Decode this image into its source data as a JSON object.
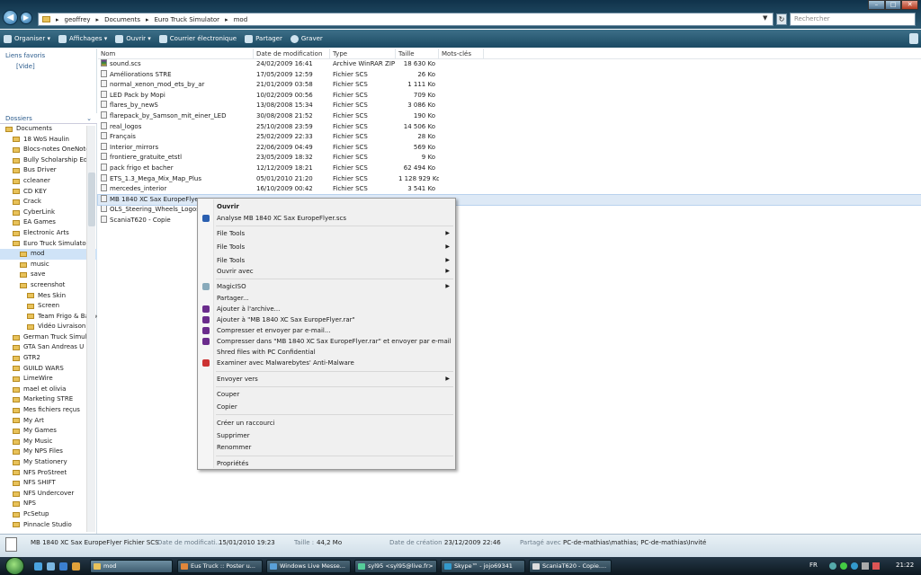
{
  "address": {
    "crumbs": [
      "geoffrey",
      "Documents",
      "Euro Truck Simulator",
      "mod"
    ],
    "search_placeholder": "Rechercher",
    "back_icon": "back-arrow-icon",
    "forward_icon": "forward-arrow-icon"
  },
  "toolbar": {
    "organiser": "Organiser",
    "affichages": "Affichages",
    "ouvrir": "Ouvrir",
    "courrier": "Courrier électronique",
    "partager": "Partager",
    "graver": "Graver"
  },
  "left": {
    "favorites_title": "Liens favoris",
    "favorites_empty": "[Vide]",
    "folders_title": "Dossiers",
    "folders": [
      "Documents",
      "18 WoS Haulin",
      "Blocs-notes OneNote",
      "Bully Scholarship Ed",
      "Bus Driver",
      "ccleaner",
      "CD KEY",
      "Crack",
      "CyberLink",
      "EA Games",
      "Electronic Arts",
      "Euro Truck Simulator",
      "mod",
      "music",
      "save",
      "screenshot",
      "Mes Skin",
      "Screen",
      "Team Frigo & Bache",
      "Vidéo Livraison de",
      "German Truck Simul",
      "GTA San Andreas U",
      "GTR2",
      "GUILD WARS",
      "LimeWire",
      "mael et olivia",
      "Marketing STRE",
      "Mes fichiers reçus",
      "My Art",
      "My Games",
      "My Music",
      "My NPS Files",
      "My Stationery",
      "NFS ProStreet",
      "NFS SHIFT",
      "NFS Undercover",
      "NPS",
      "PcSetup",
      "Pinnacle Studio"
    ]
  },
  "list": {
    "columns": [
      "Nom",
      "Date de modification",
      "Type",
      "Taille",
      "Mots-clés"
    ],
    "rows": [
      [
        "sound.scs",
        "24/02/2009 16:41",
        "Archive WinRAR ZIP",
        "18 630 Ko"
      ],
      [
        "Améliorations STRE",
        "17/05/2009 12:59",
        "Fichier SCS",
        "26 Ko"
      ],
      [
        "normal_xenon_mod_ets_by_ar",
        "21/01/2009 03:58",
        "Fichier SCS",
        "1 111 Ko"
      ],
      [
        "LED Pack by Mopi",
        "10/02/2009 00:56",
        "Fichier SCS",
        "709 Ko"
      ],
      [
        "flares_by_newS",
        "13/08/2008 15:34",
        "Fichier SCS",
        "3 086 Ko"
      ],
      [
        "flarepack_by_Samson_mit_einer_LED",
        "30/08/2008 21:52",
        "Fichier SCS",
        "190 Ko"
      ],
      [
        "real_logos",
        "25/10/2008 23:59",
        "Fichier SCS",
        "14 506 Ko"
      ],
      [
        "Français",
        "25/02/2009 22:33",
        "Fichier SCS",
        "28 Ko"
      ],
      [
        "Interior_mirrors",
        "22/06/2009 04:49",
        "Fichier SCS",
        "569 Ko"
      ],
      [
        "frontiere_gratuite_etstl",
        "23/05/2009 18:32",
        "Fichier SCS",
        "9 Ko"
      ],
      [
        "pack frigo et bacher",
        "12/12/2009 18:21",
        "Fichier SCS",
        "62 494 Ko"
      ],
      [
        "ETS_1.3_Mega_Mix_Map_Plus",
        "05/01/2010 21:20",
        "Fichier SCS",
        "1 128 929 Ko"
      ],
      [
        "mercedes_interior",
        "16/10/2009 00:42",
        "Fichier SCS",
        "3 541 Ko"
      ],
      [
        "MB 1840 XC Sax EuropeFlyer",
        "",
        "",
        ""
      ],
      [
        "OLS_Steering_Wheels_Logos_A",
        "",
        "",
        ""
      ],
      [
        "ScaniaT620 - Copie",
        "",
        "",
        ""
      ]
    ]
  },
  "context_menu": {
    "items": [
      "Ouvrir",
      "Analyse MB 1840 XC Sax EuropeFlyer.scs",
      "File Tools",
      "File Tools",
      "File Tools",
      "Ouvrir avec",
      "MagicISO",
      "Partager...",
      "Ajouter à l'archive...",
      "Ajouter à \"MB 1840 XC Sax EuropeFlyer.rar\"",
      "Compresser et envoyer par e-mail...",
      "Compresser dans \"MB 1840 XC Sax EuropeFlyer.rar\" et envoyer par e-mail",
      "Shred files with PC Confidential",
      "Examiner avec Malwarebytes' Anti-Malware",
      "Envoyer vers",
      "Couper",
      "Copier",
      "Créer un raccourci",
      "Supprimer",
      "Renommer",
      "Propriétés"
    ]
  },
  "details": {
    "name_type": "MB 1840 XC Sax EuropeFlyer  Fichier SCS",
    "modified_label": "Date de modificati...",
    "modified_value": "15/01/2010 19:23",
    "size_label": "Taille :",
    "size_value": "44,2 Mo",
    "created_label": "Date de création :",
    "created_value": "23/12/2009 22:46",
    "shared_label": "Partagé avec :",
    "shared_value": "PC-de-mathias\\mathias; PC-de-mathias\\Invité"
  },
  "taskbar": {
    "buttons": [
      "mod",
      "Eus Truck :: Poster u...",
      "Windows Live Messe...",
      "syl95 <syl95@live.fr>",
      "Skype™ - jojo69341",
      "ScaniaT620 - Copie...."
    ],
    "lang": "FR",
    "time": "21:22"
  },
  "colors": {
    "accent": "#2b5b8c",
    "selection": "#dde9f6",
    "taskbar": "#0d1820"
  }
}
